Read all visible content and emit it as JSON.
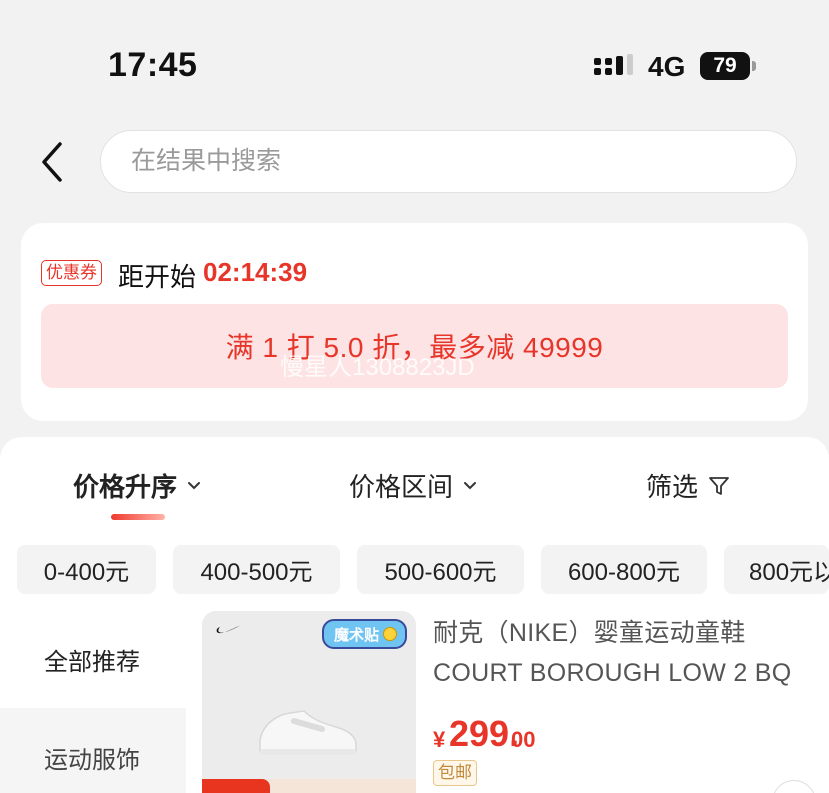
{
  "status_bar": {
    "time": "17:45",
    "network": "4G",
    "battery": "79"
  },
  "search": {
    "placeholder": "在结果中搜索"
  },
  "coupon": {
    "tag": "优惠券",
    "countdown_label": "距开始",
    "countdown_time": "02:14:39",
    "offer": "满 1 打 5.0 折，最多减 49999",
    "watermark": "慢星人1308823JD"
  },
  "sort_tabs": [
    {
      "label": "价格升序",
      "icon": "chevron-down-icon"
    },
    {
      "label": "价格区间",
      "icon": "chevron-down-icon"
    },
    {
      "label": "筛选",
      "icon": "filter-icon"
    }
  ],
  "price_ranges": [
    "0-400元",
    "400-500元",
    "500-600元",
    "600-800元",
    "800元以"
  ],
  "categories": [
    "全部推荐",
    "运动服饰"
  ],
  "product": {
    "badge": "魔术贴",
    "title": "耐克（NIKE）婴童运动童鞋 COURT BOROUGH LOW 2 BQ",
    "currency": "¥",
    "price_int": "299.",
    "price_dec": "00",
    "shipping": "包邮"
  },
  "colors": {
    "accent_red": "#e8352a",
    "banner_pink": "#fde3e3"
  }
}
